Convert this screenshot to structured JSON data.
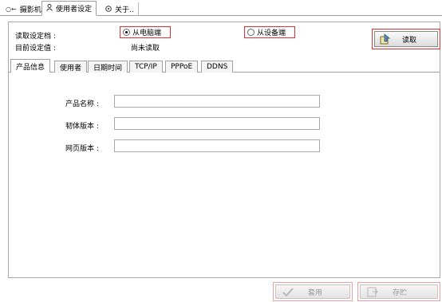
{
  "top_tabs": [
    {
      "label": "摄影机",
      "icon": "camera-icon"
    },
    {
      "label": "使用者设定",
      "icon": "user-icon"
    },
    {
      "label": "关于..",
      "icon": "info-icon"
    }
  ],
  "read_settings": {
    "label": "读取设定档 :",
    "option_pc": "从电脑端",
    "option_device": "从设备端",
    "selected": "option_pc",
    "read_button": "读取"
  },
  "current": {
    "label": "目前设定值 :",
    "value": "尚未读取"
  },
  "inner_tabs": [
    "产品信息",
    "使用者",
    "日期时间",
    "TCP/IP",
    "PPPoE",
    "DDNS"
  ],
  "product_info": {
    "name_label": "产品名称 :",
    "name_value": "",
    "firmware_label": "韧体版本 :",
    "firmware_value": "",
    "web_label": "网页版本 :",
    "web_value": ""
  },
  "footer": {
    "apply_label": "套用",
    "save_label": "存贮"
  }
}
